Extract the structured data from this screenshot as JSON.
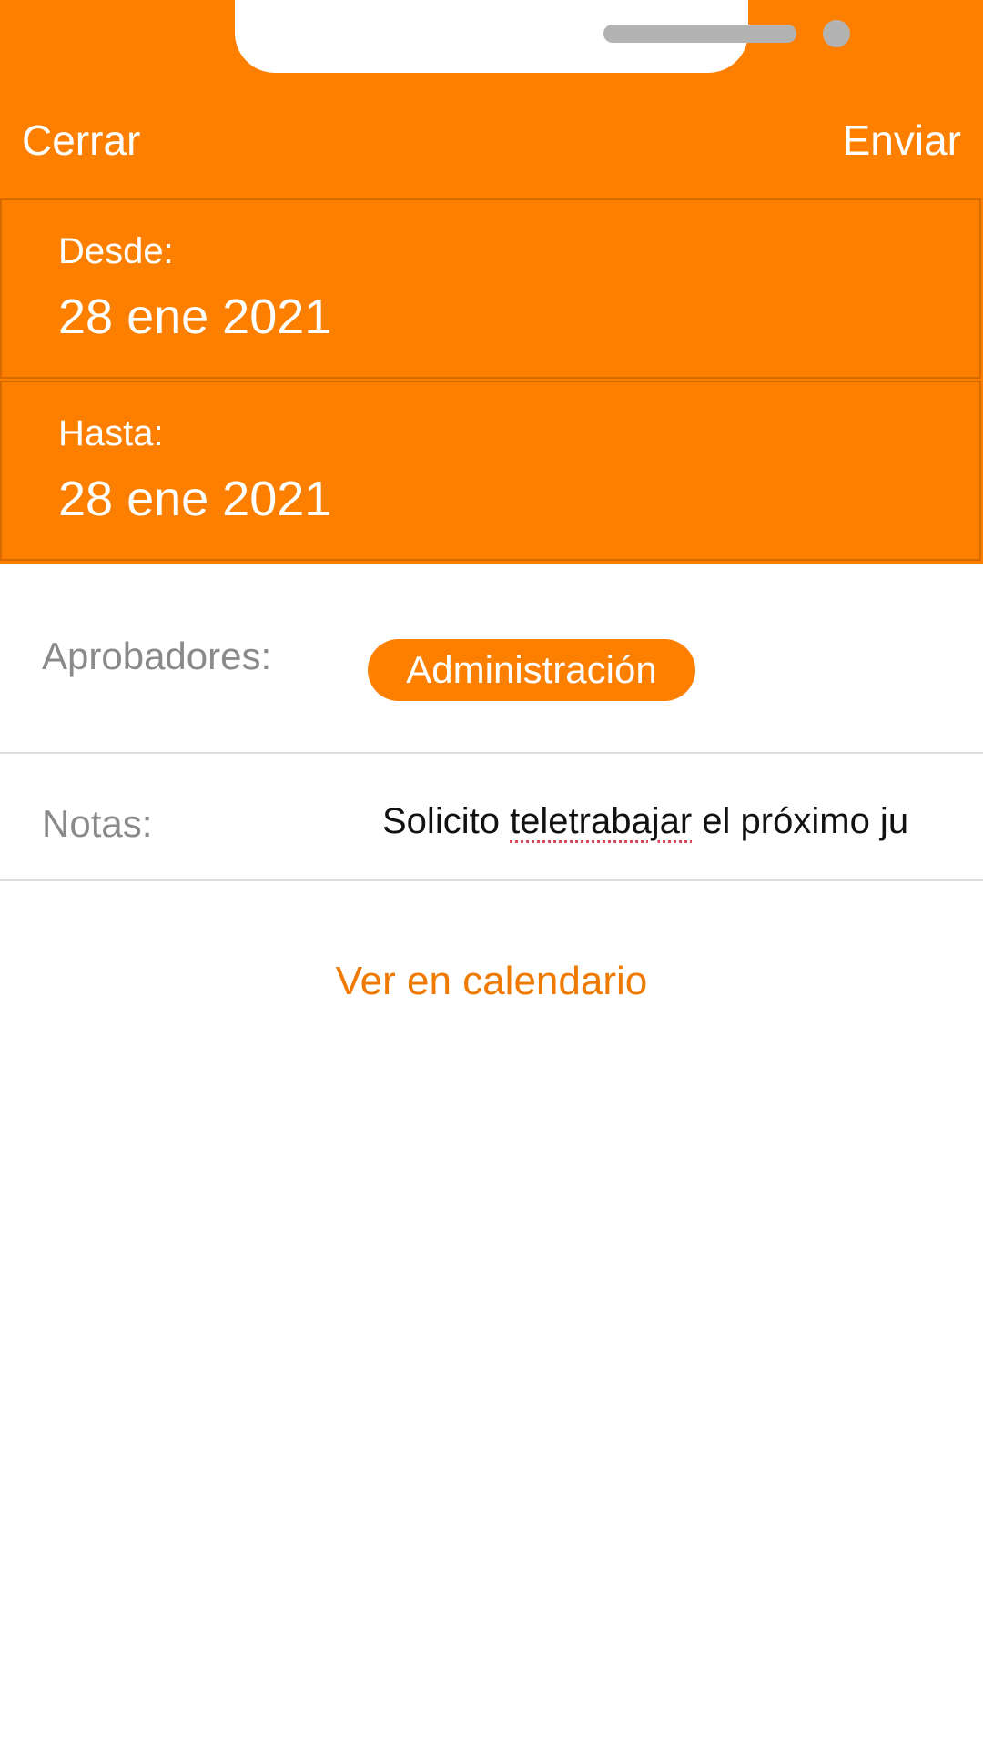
{
  "colors": {
    "accent": "#FD7F00",
    "accent_text": "#F07A00",
    "label_gray": "#8A8A8A",
    "divider": "#DDDDDD"
  },
  "nav": {
    "close_label": "Cerrar",
    "send_label": "Enviar"
  },
  "dates": {
    "from_label": "Desde:",
    "from_value": "28 ene 2021",
    "to_label": "Hasta:",
    "to_value": "28 ene 2021"
  },
  "approvers": {
    "label": "Aprobadores:",
    "chip": "Administración"
  },
  "notes": {
    "label": "Notas:",
    "text_prefix": "Solicito ",
    "text_misspelled": "teletrabajar",
    "text_suffix": " el próximo ju"
  },
  "calendar_link": "Ver en calendario"
}
